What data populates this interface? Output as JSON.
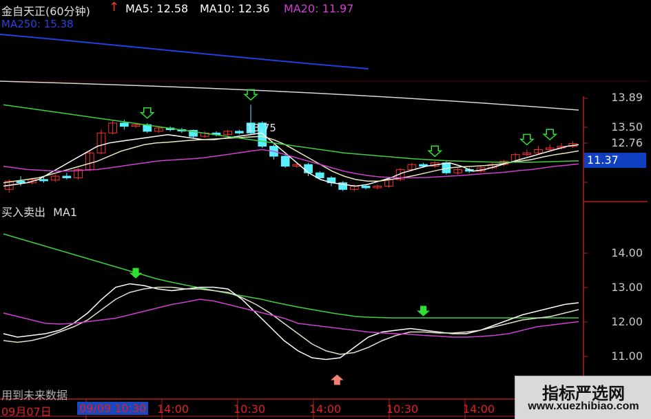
{
  "header": {
    "stock": "金自天正(60分钟)",
    "ma5": "MA5: 12.58",
    "ma10": "MA10: 12.36",
    "ma20": "MA20: 11.97",
    "ma250": "MA250: 15.38"
  },
  "price_axis": {
    "labels": [
      "13.89",
      "13.50",
      "12.76"
    ],
    "current_price": "11.37"
  },
  "peak_label": "13.75",
  "indicator": {
    "title": "买入卖出",
    "subtitle": "MA1",
    "labels": [
      "14.00",
      "13.00",
      "12.00",
      "11.00"
    ],
    "note": "用到未来数据"
  },
  "time_axis": [
    "09月07日",
    "09/09 10:30",
    "14:00",
    "10:30",
    "14:00",
    "10:30",
    "14:00"
  ],
  "watermark": {
    "title": "指标严选网",
    "url": "www.xuezhibiao.com"
  },
  "colors": {
    "up": "#ff3030",
    "down": "#58f0ff",
    "ma5": "#ffffff",
    "ma20": "#d040d0",
    "ma60": "#40d040",
    "ma250": "#2040e0",
    "signal": "#30e030",
    "grid": "#b02020"
  },
  "chart_data": [
    {
      "type": "candlestick",
      "title": "金自天正(60分钟)",
      "ylim": [
        11.0,
        13.9
      ],
      "series": [
        {
          "name": "MA5",
          "values": [
            11.3,
            11.35,
            11.4,
            11.5,
            11.7,
            11.9,
            12.1,
            12.3,
            12.5,
            12.6,
            12.65,
            12.7,
            12.75,
            12.8,
            12.85,
            12.8,
            12.75,
            12.7,
            12.7,
            12.75,
            12.8,
            12.85,
            12.9,
            12.6,
            12.3,
            12.0,
            11.7,
            11.5,
            11.4,
            11.35,
            11.3,
            11.35,
            11.45,
            11.55,
            11.7,
            11.8,
            11.9,
            11.95,
            12.0,
            11.9,
            11.75,
            11.8,
            11.9,
            12.0,
            12.1,
            12.2,
            12.3,
            12.4,
            12.5,
            12.55
          ]
        },
        {
          "name": "MA10",
          "values": [
            11.4,
            11.45,
            11.5,
            11.55,
            11.65,
            11.75,
            11.85,
            11.95,
            12.05,
            12.2,
            12.35,
            12.45,
            12.55,
            12.6,
            12.62,
            12.65,
            12.68,
            12.7,
            12.72,
            12.74,
            12.76,
            12.78,
            12.8,
            12.7,
            12.55,
            12.35,
            12.15,
            11.95,
            11.75,
            11.6,
            11.5,
            11.45,
            11.45,
            11.5,
            11.55,
            11.62,
            11.7,
            11.78,
            11.85,
            11.88,
            11.9,
            11.92,
            11.95,
            12.0,
            12.05,
            12.1,
            12.18,
            12.25,
            12.3,
            12.36
          ]
        },
        {
          "name": "MA20",
          "values": [
            11.9,
            11.85,
            11.8,
            11.78,
            11.76,
            11.75,
            11.76,
            11.78,
            11.8,
            11.85,
            11.9,
            11.95,
            12.0,
            12.05,
            12.08,
            12.1,
            12.12,
            12.15,
            12.2,
            12.25,
            12.3,
            12.35,
            12.4,
            12.35,
            12.25,
            12.15,
            12.05,
            11.95,
            11.85,
            11.75,
            11.68,
            11.62,
            11.58,
            11.56,
            11.55,
            11.55,
            11.56,
            11.58,
            11.6,
            11.62,
            11.65,
            11.68,
            11.7,
            11.73,
            11.77,
            11.8,
            11.85,
            11.9,
            11.93,
            11.97
          ]
        },
        {
          "name": "MA250",
          "values": [
            15.38,
            15.37,
            15.36,
            15.35,
            15.34,
            15.33,
            15.32,
            15.31,
            15.3,
            15.29,
            15.28,
            15.27,
            15.26,
            15.25,
            15.24,
            15.23,
            15.22,
            15.21,
            15.2,
            15.19,
            15.18,
            15.17,
            15.16,
            15.15,
            15.14,
            15.13,
            15.12,
            15.11,
            15.1,
            15.09,
            15.08,
            15.07,
            15.06,
            15.05,
            15.04,
            15.03,
            15.02,
            15.01,
            15.0,
            14.99,
            14.98,
            14.97,
            14.96,
            14.95,
            14.94,
            14.93,
            14.92,
            14.91,
            14.9,
            14.89
          ]
        },
        {
          "name": "MA60",
          "values": [
            13.75,
            13.7,
            13.65,
            13.6,
            13.55,
            13.5,
            13.45,
            13.4,
            13.35,
            13.3,
            13.25,
            13.2,
            13.15,
            13.1,
            13.05,
            13.0,
            12.95,
            12.9,
            12.85,
            12.8,
            12.75,
            12.7,
            12.65,
            12.6,
            12.55,
            12.5,
            12.45,
            12.4,
            12.35,
            12.3,
            12.27,
            12.24,
            12.21,
            12.18,
            12.15,
            12.12,
            12.1,
            12.08,
            12.06,
            12.05,
            12.04,
            12.03,
            12.02,
            12.02,
            12.02,
            12.02,
            12.03,
            12.04,
            12.05,
            12.06
          ]
        }
      ],
      "candles": [
        {
          "o": 11.2,
          "c": 11.45,
          "h": 11.5,
          "l": 11.1,
          "dir": "up"
        },
        {
          "o": 11.45,
          "c": 11.4,
          "h": 11.6,
          "l": 11.3,
          "dir": "down"
        },
        {
          "o": 11.4,
          "c": 11.5,
          "h": 11.55,
          "l": 11.35,
          "dir": "up"
        },
        {
          "o": 11.5,
          "c": 11.48,
          "h": 11.6,
          "l": 11.4,
          "dir": "down"
        },
        {
          "o": 11.48,
          "c": 11.6,
          "h": 11.65,
          "l": 11.42,
          "dir": "up"
        },
        {
          "o": 11.6,
          "c": 11.55,
          "h": 11.7,
          "l": 11.5,
          "dir": "down"
        },
        {
          "o": 11.55,
          "c": 11.8,
          "h": 11.85,
          "l": 11.5,
          "dir": "up"
        },
        {
          "o": 11.8,
          "c": 12.3,
          "h": 12.35,
          "l": 11.75,
          "dir": "up"
        },
        {
          "o": 12.3,
          "c": 12.9,
          "h": 13.0,
          "l": 12.25,
          "dir": "up"
        },
        {
          "o": 12.9,
          "c": 13.2,
          "h": 13.3,
          "l": 12.85,
          "dir": "up"
        },
        {
          "o": 13.2,
          "c": 13.1,
          "h": 13.3,
          "l": 13.0,
          "dir": "down"
        },
        {
          "o": 13.1,
          "c": 13.15,
          "h": 13.2,
          "l": 13.05,
          "dir": "up"
        },
        {
          "o": 13.15,
          "c": 12.95,
          "h": 13.2,
          "l": 12.9,
          "dir": "down"
        },
        {
          "o": 12.95,
          "c": 13.05,
          "h": 13.1,
          "l": 12.9,
          "dir": "up"
        },
        {
          "o": 13.05,
          "c": 13.0,
          "h": 13.1,
          "l": 12.95,
          "dir": "down"
        },
        {
          "o": 13.0,
          "c": 12.98,
          "h": 13.05,
          "l": 12.9,
          "dir": "down"
        },
        {
          "o": 12.98,
          "c": 12.8,
          "h": 13.0,
          "l": 12.75,
          "dir": "down"
        },
        {
          "o": 12.8,
          "c": 12.9,
          "h": 12.95,
          "l": 12.75,
          "dir": "up"
        },
        {
          "o": 12.9,
          "c": 12.85,
          "h": 12.95,
          "l": 12.8,
          "dir": "down"
        },
        {
          "o": 12.85,
          "c": 12.95,
          "h": 13.0,
          "l": 12.8,
          "dir": "up"
        },
        {
          "o": 12.95,
          "c": 12.9,
          "h": 13.0,
          "l": 12.85,
          "dir": "down"
        },
        {
          "o": 12.9,
          "c": 13.2,
          "h": 13.75,
          "l": 12.85,
          "dir": "down"
        },
        {
          "o": 13.2,
          "c": 12.5,
          "h": 13.25,
          "l": 12.45,
          "dir": "down"
        },
        {
          "o": 12.5,
          "c": 12.2,
          "h": 12.55,
          "l": 12.1,
          "dir": "down"
        },
        {
          "o": 12.2,
          "c": 11.9,
          "h": 12.25,
          "l": 11.85,
          "dir": "down"
        },
        {
          "o": 11.9,
          "c": 11.95,
          "h": 12.0,
          "l": 11.85,
          "dir": "up"
        },
        {
          "o": 11.95,
          "c": 11.7,
          "h": 12.0,
          "l": 11.6,
          "dir": "down"
        },
        {
          "o": 11.7,
          "c": 11.55,
          "h": 11.75,
          "l": 11.5,
          "dir": "down"
        },
        {
          "o": 11.55,
          "c": 11.4,
          "h": 11.6,
          "l": 11.3,
          "dir": "down"
        },
        {
          "o": 11.4,
          "c": 11.2,
          "h": 11.45,
          "l": 11.15,
          "dir": "down"
        },
        {
          "o": 11.2,
          "c": 11.3,
          "h": 11.35,
          "l": 11.15,
          "dir": "up"
        },
        {
          "o": 11.3,
          "c": 11.25,
          "h": 11.35,
          "l": 11.2,
          "dir": "down"
        },
        {
          "o": 11.25,
          "c": 11.3,
          "h": 11.35,
          "l": 11.2,
          "dir": "up"
        },
        {
          "o": 11.3,
          "c": 11.5,
          "h": 11.55,
          "l": 11.25,
          "dir": "up"
        },
        {
          "o": 11.5,
          "c": 11.8,
          "h": 11.85,
          "l": 11.45,
          "dir": "up"
        },
        {
          "o": 11.8,
          "c": 11.95,
          "h": 12.0,
          "l": 11.75,
          "dir": "up"
        },
        {
          "o": 11.95,
          "c": 11.9,
          "h": 12.0,
          "l": 11.85,
          "dir": "down"
        },
        {
          "o": 11.9,
          "c": 12.0,
          "h": 12.05,
          "l": 11.85,
          "dir": "up"
        },
        {
          "o": 12.0,
          "c": 11.7,
          "h": 12.05,
          "l": 11.65,
          "dir": "down"
        },
        {
          "o": 11.7,
          "c": 11.8,
          "h": 11.85,
          "l": 11.65,
          "dir": "up"
        },
        {
          "o": 11.8,
          "c": 11.75,
          "h": 11.85,
          "l": 11.7,
          "dir": "down"
        },
        {
          "o": 11.75,
          "c": 11.85,
          "h": 11.9,
          "l": 11.7,
          "dir": "up"
        },
        {
          "o": 11.85,
          "c": 11.95,
          "h": 12.0,
          "l": 11.8,
          "dir": "up"
        },
        {
          "o": 11.95,
          "c": 12.05,
          "h": 12.1,
          "l": 11.9,
          "dir": "up"
        },
        {
          "o": 12.05,
          "c": 12.25,
          "h": 12.3,
          "l": 12.0,
          "dir": "up"
        },
        {
          "o": 12.25,
          "c": 12.3,
          "h": 12.4,
          "l": 12.2,
          "dir": "up"
        },
        {
          "o": 12.3,
          "c": 12.4,
          "h": 12.5,
          "l": 12.25,
          "dir": "up"
        },
        {
          "o": 12.4,
          "c": 12.45,
          "h": 12.55,
          "l": 12.35,
          "dir": "up"
        },
        {
          "o": 12.45,
          "c": 12.5,
          "h": 12.6,
          "l": 12.4,
          "dir": "up"
        },
        {
          "o": 12.5,
          "c": 12.58,
          "h": 12.65,
          "l": 12.45,
          "dir": "up"
        }
      ],
      "signals": [
        {
          "index": 12,
          "kind": "sell"
        },
        {
          "index": 21,
          "kind": "sell"
        },
        {
          "index": 37,
          "kind": "sell"
        },
        {
          "index": 45,
          "kind": "sell"
        },
        {
          "index": 47,
          "kind": "sell"
        }
      ]
    },
    {
      "type": "line",
      "title": "买入卖出 MA1",
      "ylim": [
        10.5,
        14.5
      ],
      "series": [
        {
          "name": "MA1",
          "values": [
            14.6,
            14.5,
            14.4,
            14.3,
            14.2,
            14.1,
            14.0,
            13.9,
            13.8,
            13.7,
            13.6,
            13.5,
            13.4,
            13.3,
            13.22,
            13.15,
            13.08,
            13.02,
            12.95,
            12.88,
            12.82,
            12.76,
            12.7,
            12.62,
            12.55,
            12.48,
            12.42,
            12.36,
            12.3,
            12.25,
            12.2,
            12.18,
            12.17,
            12.16,
            12.16,
            12.16,
            12.16,
            12.16,
            12.16,
            12.16,
            12.16,
            12.16,
            12.16,
            12.16,
            12.16,
            12.16,
            12.16,
            12.16,
            12.16,
            12.16
          ]
        },
        {
          "name": "",
          "values": [
            11.7,
            11.6,
            11.65,
            11.7,
            11.8,
            12.0,
            12.3,
            12.7,
            13.05,
            13.15,
            13.1,
            13.0,
            12.95,
            13.0,
            13.05,
            13.05,
            13.0,
            12.7,
            12.3,
            11.9,
            11.5,
            11.2,
            11.0,
            10.95,
            11.0,
            11.3,
            11.6,
            11.75,
            11.8,
            11.85,
            11.8,
            11.75,
            11.7,
            11.7,
            11.8,
            11.95,
            12.1,
            12.25,
            12.35,
            12.45,
            12.55,
            12.6
          ]
        },
        {
          "name": "",
          "values": [
            11.5,
            11.45,
            11.5,
            11.6,
            11.75,
            11.9,
            12.1,
            12.4,
            12.7,
            12.9,
            13.0,
            13.05,
            13.05,
            13.0,
            13.0,
            12.95,
            12.9,
            12.75,
            12.55,
            12.3,
            12.0,
            11.7,
            11.4,
            11.2,
            11.1,
            11.15,
            11.3,
            11.5,
            11.65,
            11.75,
            11.75,
            11.72,
            11.72,
            11.75,
            11.8,
            11.9,
            12.0,
            12.1,
            12.15,
            12.2,
            12.3,
            12.4
          ]
        },
        {
          "name": "",
          "values": [
            12.3,
            12.2,
            12.1,
            12.0,
            11.98,
            12.0,
            12.05,
            12.1,
            12.15,
            12.25,
            12.35,
            12.45,
            12.55,
            12.62,
            12.7,
            12.65,
            12.55,
            12.45,
            12.35,
            12.25,
            12.15,
            12.0,
            11.95,
            11.9,
            11.85,
            11.8,
            11.75,
            11.72,
            11.7,
            11.68,
            11.65,
            11.63,
            11.6,
            11.6,
            11.62,
            11.65,
            11.7,
            11.8,
            11.9,
            11.95,
            12.0,
            12.05
          ]
        }
      ],
      "signals": [
        {
          "x": 0.23,
          "value": 13.6,
          "kind": "sell"
        },
        {
          "x": 0.73,
          "value": 12.5,
          "kind": "sell"
        },
        {
          "x": 0.58,
          "value": 10.5,
          "kind": "buy"
        }
      ]
    }
  ]
}
